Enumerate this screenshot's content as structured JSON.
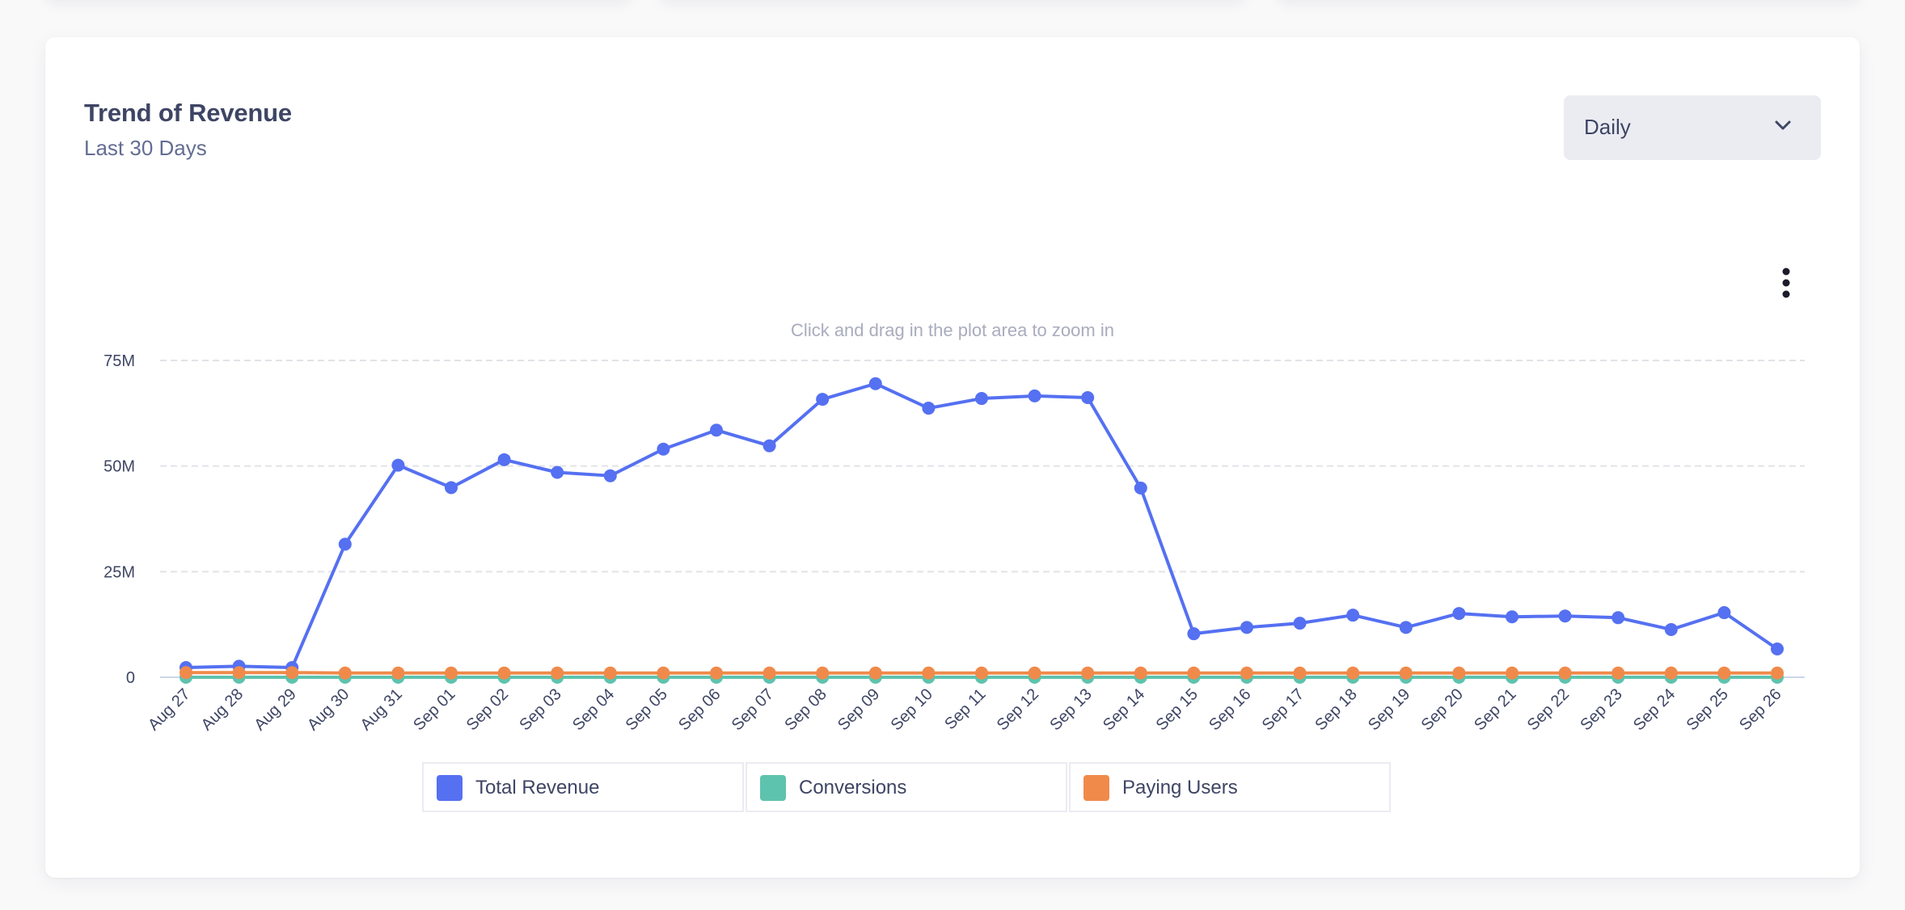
{
  "card": {
    "title": "Trend of Revenue",
    "subtitle": "Last 30 Days"
  },
  "dropdown": {
    "selected": "Daily",
    "icon": "chevron-down-icon"
  },
  "menu": {
    "icon": "more-vertical-icon"
  },
  "chart_hint": "Click and drag in the plot area to zoom in",
  "colors": {
    "total_revenue": "#5570f1",
    "conversions": "#5ec3ae",
    "paying_users": "#f08a4b",
    "grid": "#e2e3e8",
    "axis": "#ccd6eb",
    "text": "#3e4564"
  },
  "legend": [
    {
      "label": "Total Revenue",
      "color": "#5570f1"
    },
    {
      "label": "Conversions",
      "color": "#5ec3ae"
    },
    {
      "label": "Paying Users",
      "color": "#f08a4b"
    }
  ],
  "chart_data": {
    "type": "line",
    "title": "Trend of Revenue",
    "subtitle": "Last 30 Days",
    "xlabel": "",
    "ylabel": "",
    "ylim": [
      0,
      75000000
    ],
    "yticks": [
      0,
      25000000,
      50000000,
      75000000
    ],
    "ytick_labels": [
      "0",
      "25M",
      "50M",
      "75M"
    ],
    "grid": true,
    "legend_position": "bottom-center",
    "categories": [
      "Aug 27",
      "Aug 28",
      "Aug 29",
      "Aug 30",
      "Aug 31",
      "Sep 01",
      "Sep 02",
      "Sep 03",
      "Sep 04",
      "Sep 05",
      "Sep 06",
      "Sep 07",
      "Sep 08",
      "Sep 09",
      "Sep 10",
      "Sep 11",
      "Sep 12",
      "Sep 13",
      "Sep 14",
      "Sep 15",
      "Sep 16",
      "Sep 17",
      "Sep 18",
      "Sep 19",
      "Sep 20",
      "Sep 21",
      "Sep 22",
      "Sep 23",
      "Sep 24",
      "Sep 25",
      "Sep 26"
    ],
    "series": [
      {
        "name": "Total Revenue",
        "color": "#5570f1",
        "values": [
          2300000,
          2600000,
          2300000,
          31500000,
          50200000,
          44900000,
          51500000,
          48500000,
          47700000,
          54000000,
          58500000,
          54800000,
          65800000,
          69500000,
          63700000,
          66000000,
          66600000,
          66200000,
          44800000,
          10300000,
          11800000,
          12800000,
          14700000,
          11800000,
          15100000,
          14300000,
          14500000,
          14100000,
          11300000,
          15300000,
          6700000
        ]
      },
      {
        "name": "Conversions",
        "color": "#5ec3ae",
        "values": [
          0,
          0,
          0,
          0,
          0,
          0,
          0,
          0,
          0,
          0,
          0,
          0,
          0,
          0,
          0,
          0,
          0,
          0,
          0,
          0,
          0,
          0,
          0,
          0,
          0,
          0,
          0,
          0,
          0,
          0,
          0
        ]
      },
      {
        "name": "Paying Users",
        "color": "#f08a4b",
        "values": [
          1100000,
          1100000,
          1100000,
          1000000,
          1000000,
          1000000,
          1000000,
          1000000,
          1000000,
          1000000,
          1000000,
          1000000,
          1000000,
          1000000,
          1000000,
          1000000,
          1000000,
          1000000,
          1000000,
          1000000,
          1000000,
          1000000,
          1000000,
          1000000,
          1000000,
          1000000,
          1000000,
          1000000,
          1000000,
          1000000,
          1000000
        ]
      }
    ]
  }
}
